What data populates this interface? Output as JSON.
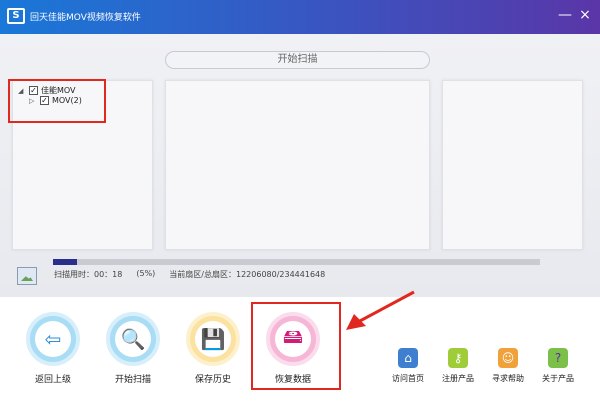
{
  "titlebar": {
    "title": "回天佳能MOV视频恢复软件",
    "minimize_glyph": "—",
    "close_glyph": "×",
    "app_icon_glyph": "S"
  },
  "scan_header": "开始扫描",
  "tree": {
    "root": {
      "label": "佳能MOV",
      "checked": true
    },
    "child": {
      "label": "MOV(2)",
      "checked": true
    }
  },
  "progress": {
    "fraction": 0.05
  },
  "status": {
    "time_label": "扫描用时：00：18",
    "percent_label": "(5%)",
    "sector_label": "当前扇区/总扇区：12206080/234441648"
  },
  "actions": [
    {
      "label": "返回上级",
      "icon": "exit-door-icon",
      "glyph": "⇦"
    },
    {
      "label": "开始扫描",
      "icon": "magnifier-icon",
      "glyph": "🔍"
    },
    {
      "label": "保存历史",
      "icon": "save-disk-icon",
      "glyph": "💾"
    },
    {
      "label": "恢复数据",
      "icon": "hard-drive-icon",
      "glyph": "🖴"
    }
  ],
  "links": [
    {
      "label": "访问首页",
      "icon": "home-icon",
      "glyph": "⌂"
    },
    {
      "label": "注册产品",
      "icon": "key-icon",
      "glyph": "⚷"
    },
    {
      "label": "寻求帮助",
      "icon": "support-agent-icon",
      "glyph": "☺"
    },
    {
      "label": "关于产品",
      "icon": "info-book-icon",
      "glyph": "?"
    }
  ],
  "colors": {
    "title_start": "#1a78d8",
    "title_end": "#5a36a8",
    "annotation_red": "#e0281e",
    "progress_fill": "#2b2f8c"
  }
}
